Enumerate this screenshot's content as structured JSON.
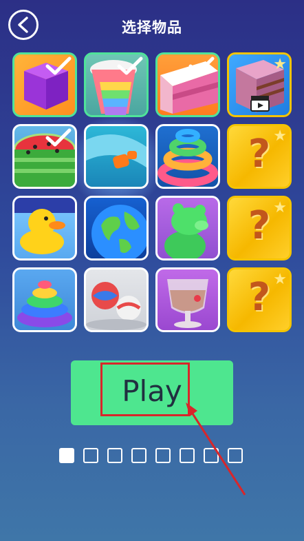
{
  "header": {
    "title": "选择物品",
    "back_icon": "back-arrow-icon"
  },
  "grid": {
    "items": [
      {
        "kind": "purple-cube",
        "selected": true
      },
      {
        "kind": "rainbow-slices",
        "selected": true
      },
      {
        "kind": "pink-layer-cake",
        "selected": true
      },
      {
        "kind": "layer-cake-video",
        "selected": false,
        "badge": "video-clapper-icon"
      },
      {
        "kind": "watermelon",
        "selected": true
      },
      {
        "kind": "fish-slide",
        "selected": false
      },
      {
        "kind": "rainbow-spiral",
        "selected": false
      },
      {
        "kind": "mystery",
        "label": "?"
      },
      {
        "kind": "rubber-duck",
        "selected": false
      },
      {
        "kind": "earth-globe",
        "selected": false
      },
      {
        "kind": "green-jelly-bear",
        "selected": false
      },
      {
        "kind": "mystery",
        "label": "?"
      },
      {
        "kind": "rainbow-swirl",
        "selected": false
      },
      {
        "kind": "swirl-balls",
        "selected": false
      },
      {
        "kind": "milkshake-glass",
        "selected": false
      },
      {
        "kind": "mystery",
        "label": "?"
      }
    ]
  },
  "play_button": {
    "label": "Play"
  },
  "pager": {
    "count": 8,
    "active_index": 0
  },
  "colors": {
    "accent": "#4ee68f",
    "highlight": "#d8262a",
    "mystery": "#f6b800"
  }
}
